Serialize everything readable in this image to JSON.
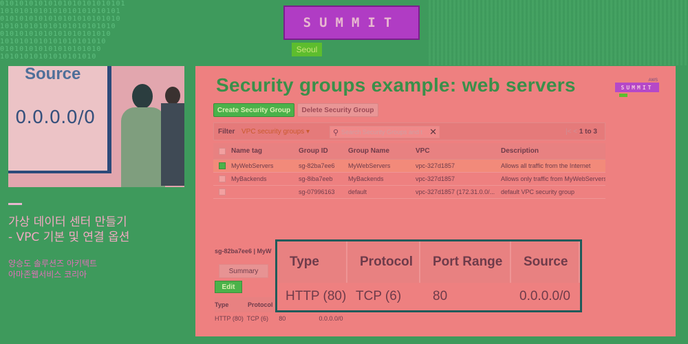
{
  "event": {
    "logo_text": "SUMMIT",
    "city": "Seoul"
  },
  "photo": {
    "slide_word": "Source",
    "slide_ip": "0.0.0.0/0"
  },
  "talk": {
    "title_line1": "가상 데이터 센터 만들기",
    "title_line2": "- VPC 기본 및 연결 옵션",
    "speaker": "양승도 솔루션즈 아키텍트",
    "org": "아마존웹서비스 코리아"
  },
  "slide": {
    "title": "Security groups example: web servers",
    "mini_logo_aws": "AWS",
    "mini_logo_text": "SUMMIT",
    "create_button": "Create Security Group",
    "delete_button": "Delete Security Group",
    "filter_label": "Filter",
    "filter_select": "VPC security groups",
    "search_placeholder": "Search Security Groups and t",
    "pager": "1 to 3",
    "table": {
      "headers": [
        "Name tag",
        "Group ID",
        "Group Name",
        "VPC",
        "Description"
      ],
      "rows": [
        {
          "name": "MyWebServers",
          "id": "sg-82ba7ee6",
          "group": "MyWebServers",
          "vpc": "vpc-327d1857",
          "desc": "Allows all traffic from the Internet",
          "selected": true
        },
        {
          "name": "MyBackends",
          "id": "sg-8iba7eeb",
          "group": "MyBackends",
          "vpc": "vpc-327d1857",
          "desc": "Allows only traffic from MyWebServers",
          "selected": false
        },
        {
          "name": "",
          "id": "sg-07996163",
          "group": "default",
          "vpc": "vpc-327d1857 (172.31.0.0/...",
          "desc": "default VPC security group",
          "selected": false
        }
      ]
    },
    "detail_id": "sg-82ba7ee6 | MyW",
    "summary_tab": "Summary",
    "edit_button": "Edit",
    "small_rules": {
      "headers": [
        "Type",
        "Protocol"
      ],
      "row": [
        "HTTP (80)",
        "TCP (6)",
        "80",
        "0.0.0.0/0"
      ]
    },
    "inbound": {
      "headers": [
        "Type",
        "Protocol",
        "Port Range",
        "Source"
      ],
      "row": [
        "HTTP (80)",
        "TCP (6)",
        "80",
        "0.0.0.0/0"
      ]
    }
  }
}
